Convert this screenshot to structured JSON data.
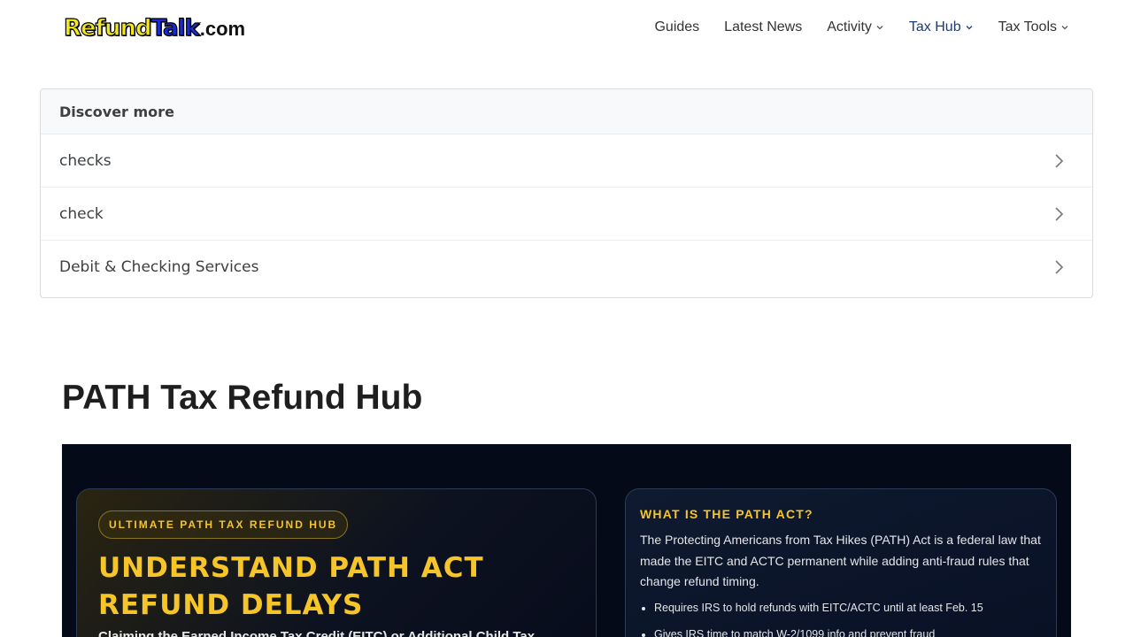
{
  "header": {
    "logo": {
      "part1": "Refund",
      "part2": "Talk",
      "part3": ".com"
    },
    "nav": [
      {
        "label": "Guides",
        "dropdown": false,
        "active": false
      },
      {
        "label": "Latest News",
        "dropdown": false,
        "active": false
      },
      {
        "label": "Activity",
        "dropdown": true,
        "active": false
      },
      {
        "label": "Tax Hub",
        "dropdown": true,
        "active": true
      },
      {
        "label": "Tax Tools",
        "dropdown": true,
        "active": false
      }
    ]
  },
  "discover": {
    "heading": "Discover more",
    "items": [
      "checks",
      "check",
      "Debit & Checking Services"
    ]
  },
  "page": {
    "title": "PATH Tax Refund Hub"
  },
  "hero": {
    "badge": "ULTIMATE PATH TAX REFUND HUB",
    "title": "UNDERSTAND PATH ACT REFUND DELAYS",
    "description": "Claiming the Earned Income Tax Credit (EITC) or Additional Child Tax",
    "info": {
      "title": "WHAT IS THE PATH ACT?",
      "body": "The Protecting Americans from Tax Hikes (PATH) Act is a federal law that made the EITC and ACTC permanent while adding anti-fraud rules that change refund timing.",
      "bullets": [
        "Requires IRS to hold refunds with EITC/ACTC until at least Feb. 15",
        "Gives IRS time to match W-2/1099 info and prevent fraud"
      ]
    }
  },
  "colors": {
    "accent_gold": "#f5c52a",
    "nav_active": "#1f3b73",
    "hero_bg": "#050a18"
  }
}
